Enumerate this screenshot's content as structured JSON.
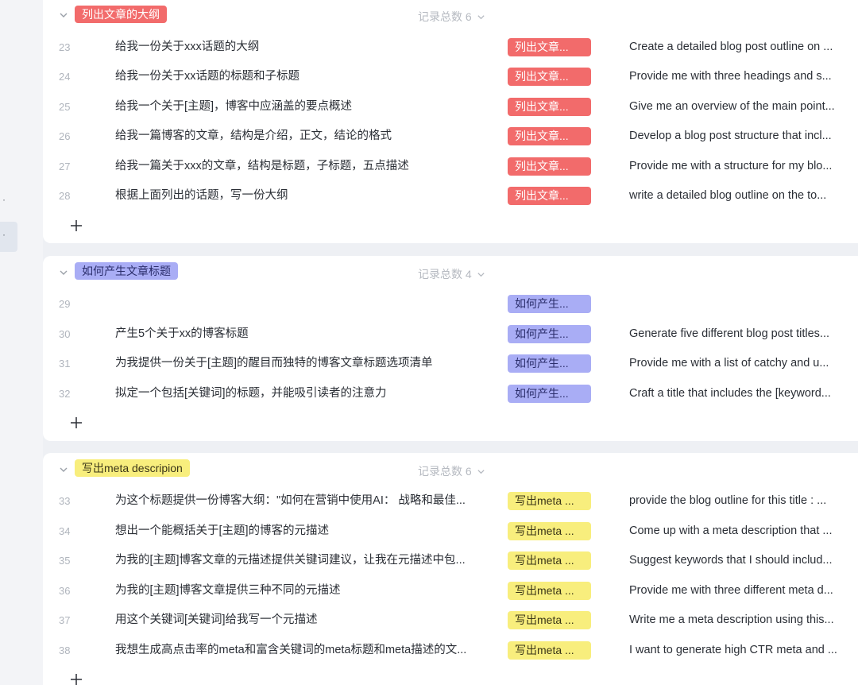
{
  "groups": [
    {
      "name": "列出文章的大纲",
      "count_label": "记录总数 6",
      "color": "#f26b6b",
      "rows": [
        {
          "num": "23",
          "cn": "给我一份关于xxx话题的大纲",
          "tag": "列出文章...",
          "en": "Create a detailed blog post outline on ..."
        },
        {
          "num": "24",
          "cn": "给我一份关于xx话题的标题和子标题",
          "tag": "列出文章...",
          "en": "Provide me with three headings and s..."
        },
        {
          "num": "25",
          "cn": "给我一个关于[主题]，博客中应涵盖的要点概述",
          "tag": "列出文章...",
          "en": "Give me an overview of the main point..."
        },
        {
          "num": "26",
          "cn": "给我一篇博客的文章，结构是介绍，正文，结论的格式",
          "tag": "列出文章...",
          "en": "Develop a blog post structure that incl..."
        },
        {
          "num": "27",
          "cn": "给我一篇关于xxx的文章，结构是标题，子标题，五点描述",
          "tag": "列出文章...",
          "en": "Provide me with a structure for my blo..."
        },
        {
          "num": "28",
          "cn": "根据上面列出的话题，写一份大纲",
          "tag": "列出文章...",
          "en": "write a detailed blog outline on the to..."
        }
      ]
    },
    {
      "name": "如何产生文章标题",
      "count_label": "记录总数 4",
      "color": "#a9adf5",
      "rows": [
        {
          "num": "29",
          "cn": "",
          "tag": "如何产生...",
          "en": ""
        },
        {
          "num": "30",
          "cn": "产生5个关于xx的博客标题",
          "tag": "如何产生...",
          "en": "Generate five different blog post titles..."
        },
        {
          "num": "31",
          "cn": "为我提供一份关于[主题]的醒目而独特的博客文章标题选项清单",
          "tag": "如何产生...",
          "en": "Provide me with a list of catchy and u..."
        },
        {
          "num": "32",
          "cn": "拟定一个包括[关键词]的标题，并能吸引读者的注意力",
          "tag": "如何产生...",
          "en": "Craft a title that includes the [keyword..."
        }
      ]
    },
    {
      "name": "写出meta descripion",
      "count_label": "记录总数 6",
      "color": "#f8ee7d",
      "rows": [
        {
          "num": "33",
          "cn": "为这个标题提供一份博客大纲：\"如何在营销中使用AI： 战略和最佳...",
          "tag": "写出meta ...",
          "en": "provide the blog outline for this title : ..."
        },
        {
          "num": "34",
          "cn": "想出一个能概括关于[主题]的博客的元描述",
          "tag": "写出meta ...",
          "en": "Come up with a meta description that ..."
        },
        {
          "num": "35",
          "cn": "为我的[主题]博客文章的元描述提供关键词建议，让我在元描述中包...",
          "tag": "写出meta ...",
          "en": "Suggest keywords that I should includ..."
        },
        {
          "num": "36",
          "cn": "为我的[主题]博客文章提供三种不同的元描述",
          "tag": "写出meta ...",
          "en": "Provide me with three different meta d..."
        },
        {
          "num": "37",
          "cn": "用这个关键词[关键词]给我写一个元描述",
          "tag": "写出meta ...",
          "en": "Write me a meta description using this..."
        },
        {
          "num": "38",
          "cn": "我想生成高点击率的meta和富含关键词的meta标题和meta描述的文...",
          "tag": "写出meta ...",
          "en": "I want to generate high CTR meta and ..."
        }
      ]
    }
  ]
}
